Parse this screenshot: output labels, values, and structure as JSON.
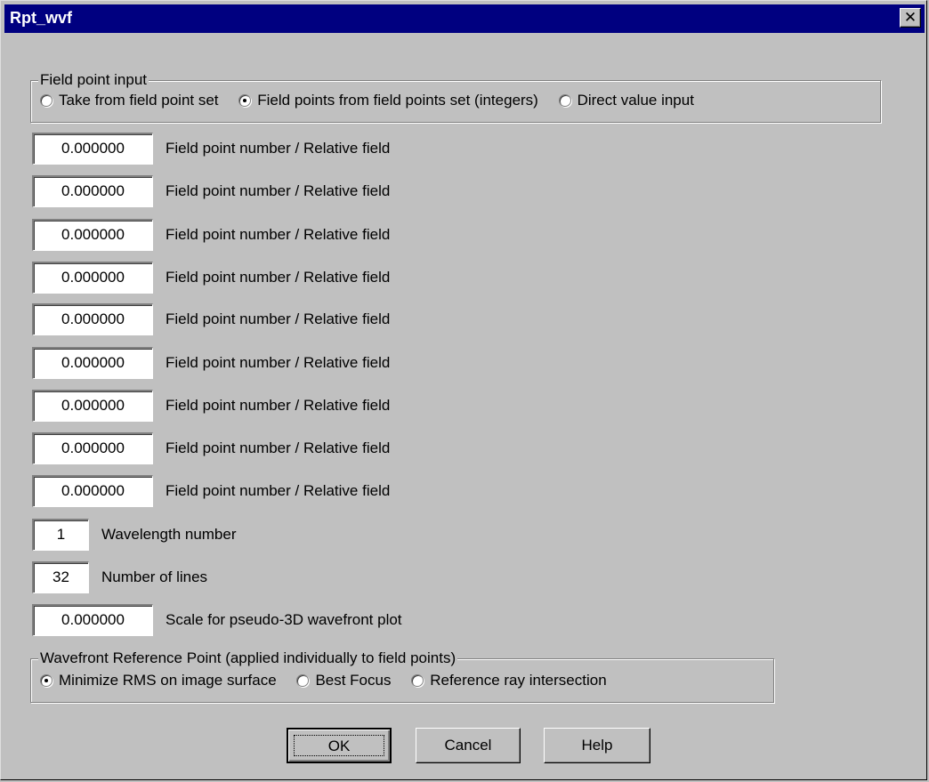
{
  "window": {
    "title": "Rpt_wvf",
    "close_glyph": "✕"
  },
  "field_point_input": {
    "title": "Field point input",
    "options": [
      {
        "label": "Take from field point set",
        "selected": false
      },
      {
        "label": "Field points from field points set (integers)",
        "selected": true
      },
      {
        "label": "Direct value input",
        "selected": false
      }
    ]
  },
  "field_rows": [
    {
      "value": "0.000000",
      "label": "Field point number / Relative field"
    },
    {
      "value": "0.000000",
      "label": "Field point number / Relative field"
    },
    {
      "value": "0.000000",
      "label": "Field point number / Relative field"
    },
    {
      "value": "0.000000",
      "label": "Field point number / Relative field"
    },
    {
      "value": "0.000000",
      "label": "Field point number / Relative field"
    },
    {
      "value": "0.000000",
      "label": "Field point number / Relative field"
    },
    {
      "value": "0.000000",
      "label": "Field point number / Relative field"
    },
    {
      "value": "0.000000",
      "label": "Field point number / Relative field"
    },
    {
      "value": "0.000000",
      "label": "Field point number / Relative field"
    }
  ],
  "wavelength": {
    "value": "1",
    "label": "Wavelength number"
  },
  "lines": {
    "value": "32",
    "label": "Number of lines"
  },
  "scale": {
    "value": "0.000000",
    "label": "Scale for pseudo-3D wavefront plot"
  },
  "reference_point": {
    "title": "Wavefront Reference Point (applied individually to field points)",
    "options": [
      {
        "label": "Minimize RMS on image surface",
        "selected": true
      },
      {
        "label": "Best Focus",
        "selected": false
      },
      {
        "label": "Reference ray intersection",
        "selected": false
      }
    ]
  },
  "buttons": {
    "ok": "OK",
    "cancel": "Cancel",
    "help": "Help"
  },
  "colors": {
    "face": "#c0c0c0",
    "titlebar": "#000080",
    "field": "#ffffff"
  }
}
